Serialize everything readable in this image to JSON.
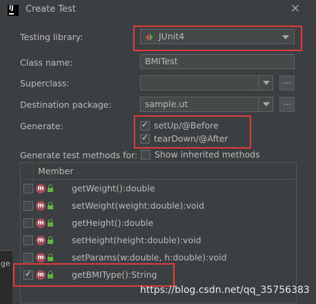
{
  "window": {
    "title": "Create Test",
    "close_glyph": "✕"
  },
  "form": {
    "testing_library_label": "Testing library:",
    "testing_library_value": "JUnit4",
    "class_name_label": "Class name:",
    "class_name_value": "BMITest",
    "superclass_label": "Superclass:",
    "superclass_value": "",
    "destination_package_label": "Destination package:",
    "destination_package_value": "sample.ut",
    "browse_label": "...",
    "generate_label": "Generate:",
    "setup_label": "setUp/@Before",
    "setup_checked": true,
    "teardown_label": "tearDown/@After",
    "teardown_checked": true,
    "generate_methods_label": "Generate test methods for:",
    "show_inherited_label": "Show inherited methods",
    "show_inherited_checked": false
  },
  "members": {
    "header": "Member",
    "rows": [
      {
        "method": "getWeight():double",
        "checked": false
      },
      {
        "method": "setWeight(weight:double):void",
        "checked": false
      },
      {
        "method": "getHeight():double",
        "checked": false
      },
      {
        "method": "setHeight(height:double):void",
        "checked": false
      },
      {
        "method": "setParams(w:double, h:double):void",
        "checked": false
      },
      {
        "method": "getBMIType():String",
        "checked": true
      }
    ],
    "method_icon_letter": "m"
  },
  "left_stub_text": "ge",
  "watermark": "https://blog.csdn.net/qq_35756383",
  "colors": {
    "background": "#3c3f41",
    "field": "#45494a",
    "highlight_box": "#e33a3a",
    "method_icon": "#a54e58",
    "lock": "#62b543"
  }
}
